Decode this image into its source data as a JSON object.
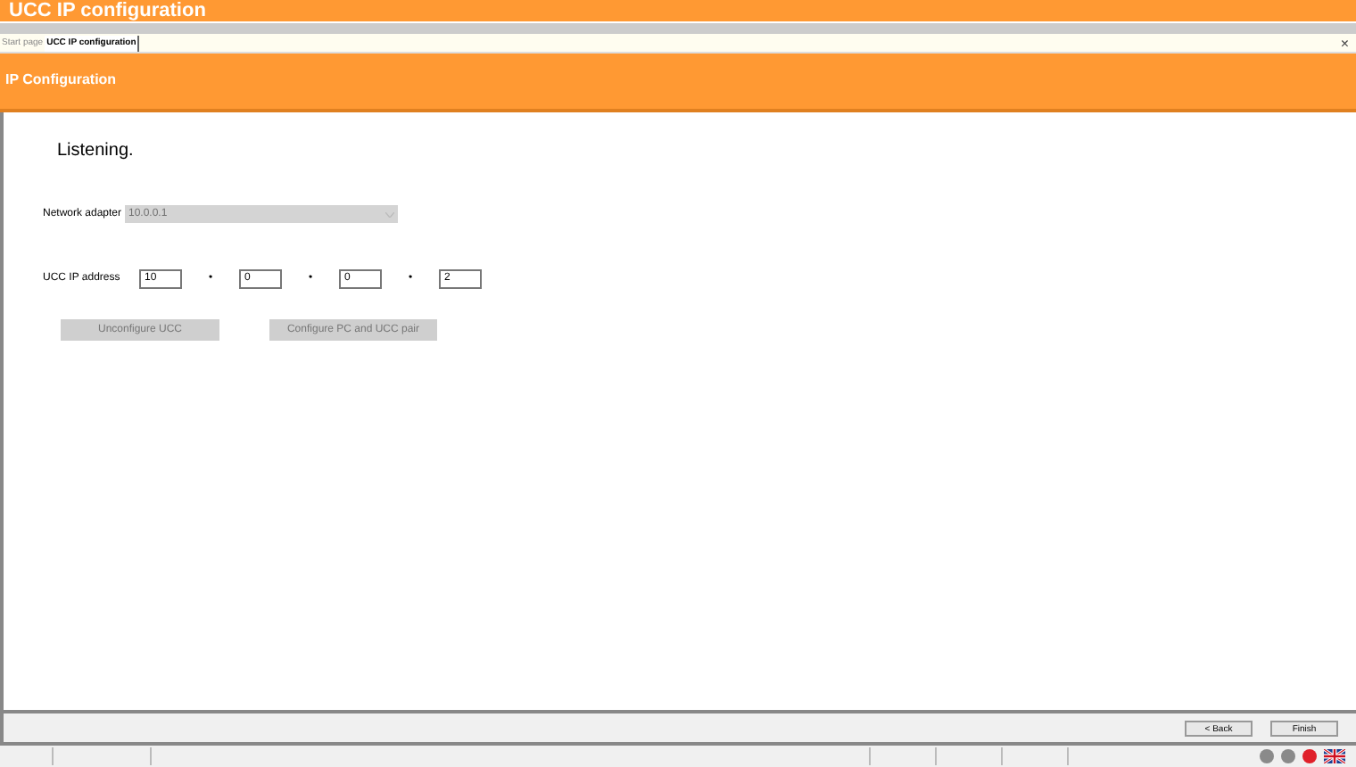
{
  "window": {
    "title": "UCC IP configuration"
  },
  "tabs": [
    {
      "label": "Start page",
      "selected": false
    },
    {
      "label": "UCC IP configuration",
      "selected": true
    }
  ],
  "tab_close": "×",
  "header": {
    "title": "IP Configuration"
  },
  "status_message": "Listening.",
  "network_adapter": {
    "label": "Network adapter",
    "value": "10.0.0.1",
    "disabled": true
  },
  "ucc_ip": {
    "label": "UCC IP address",
    "octets": [
      "10",
      "0",
      "0",
      "2"
    ],
    "separator": "•"
  },
  "actions": [
    {
      "label": "Unconfigure UCC",
      "disabled": true
    },
    {
      "label": "Configure PC and UCC pair",
      "disabled": true
    }
  ],
  "nav_buttons": [
    {
      "label": "< Back"
    },
    {
      "label": "Finish"
    }
  ],
  "status_lights": [
    {
      "color": "#8a8a8a"
    },
    {
      "color": "#8a8a8a"
    },
    {
      "color": "#e0202a"
    }
  ]
}
